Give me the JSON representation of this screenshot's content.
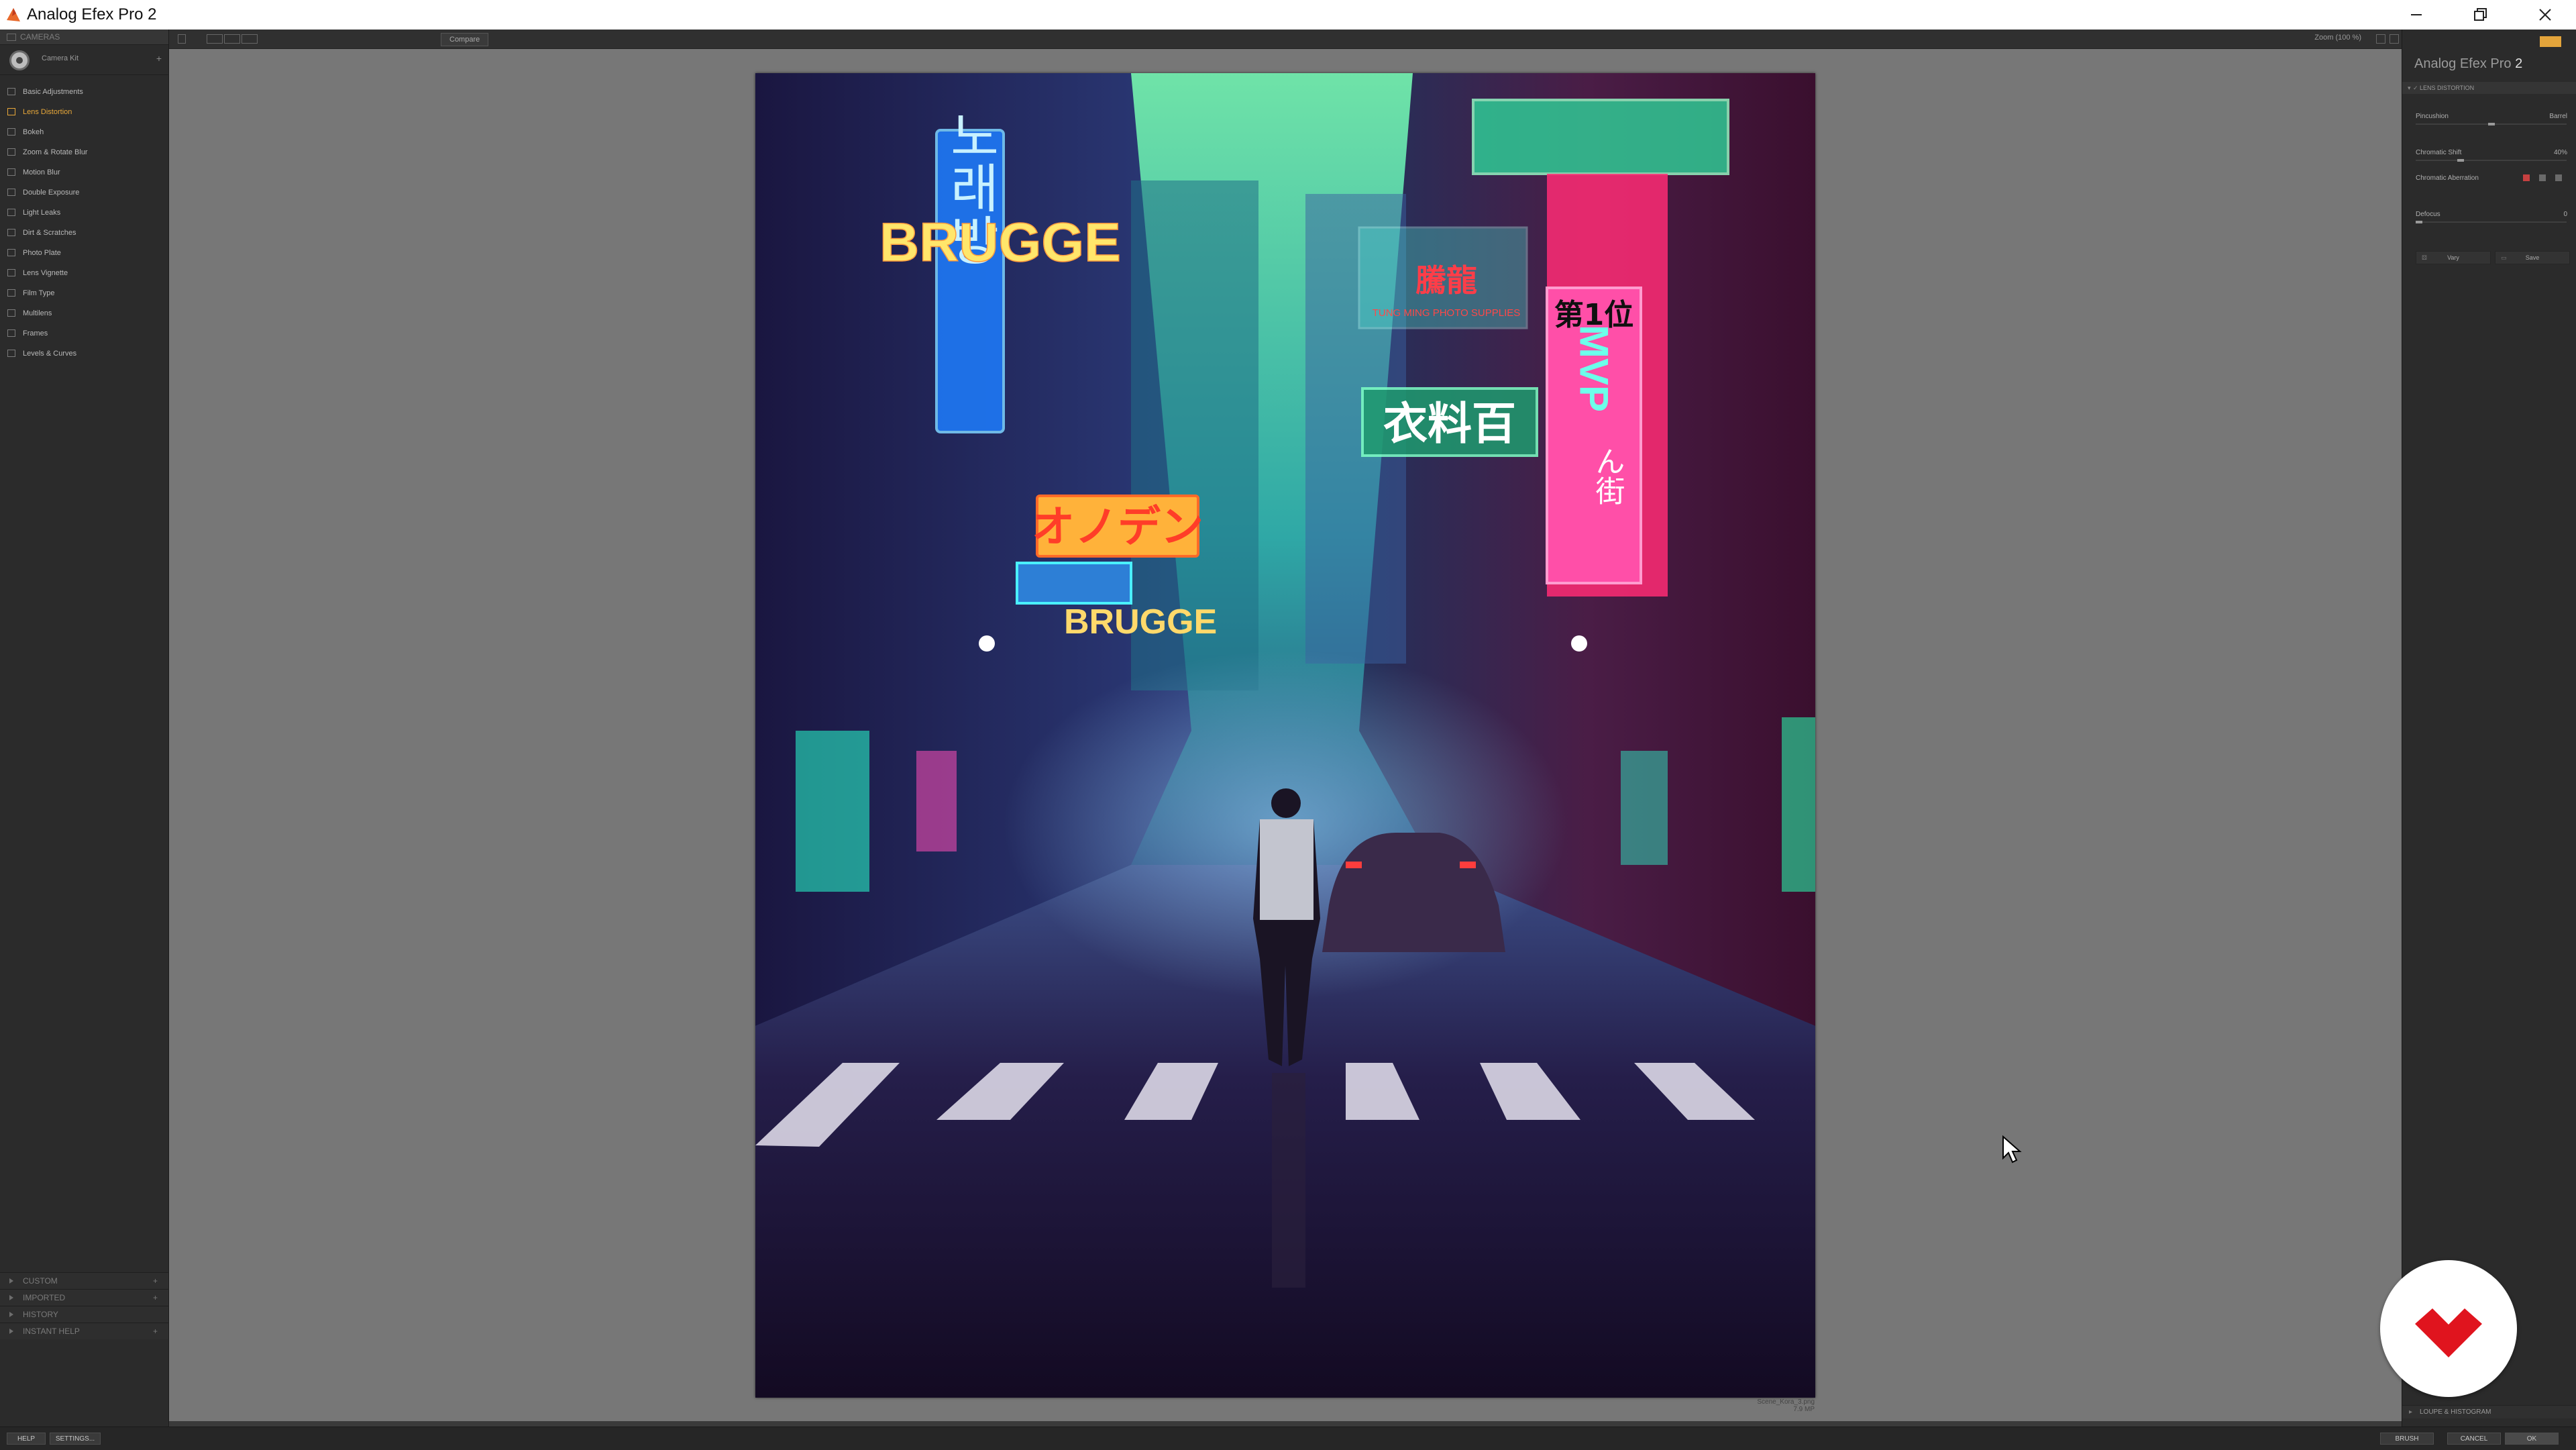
{
  "window": {
    "title": "Analog Efex Pro 2",
    "controls": [
      "minimize",
      "restore",
      "close"
    ]
  },
  "left_panel": {
    "header": "CAMERAS",
    "camera_kit": "Camera Kit",
    "tools": [
      {
        "label": "Basic Adjustments",
        "active": false
      },
      {
        "label": "Lens Distortion",
        "active": true
      },
      {
        "label": "Bokeh",
        "active": false
      },
      {
        "label": "Zoom & Rotate Blur",
        "active": false
      },
      {
        "label": "Motion Blur",
        "active": false
      },
      {
        "label": "Double Exposure",
        "active": false
      },
      {
        "label": "Light Leaks",
        "active": false
      },
      {
        "label": "Dirt & Scratches",
        "active": false
      },
      {
        "label": "Photo Plate",
        "active": false
      },
      {
        "label": "Lens Vignette",
        "active": false
      },
      {
        "label": "Film Type",
        "active": false
      },
      {
        "label": "Multilens",
        "active": false
      },
      {
        "label": "Frames",
        "active": false
      },
      {
        "label": "Levels & Curves",
        "active": false
      }
    ],
    "bottom_sections": [
      "CUSTOM",
      "IMPORTED",
      "HISTORY",
      "INSTANT HELP"
    ]
  },
  "toolbar": {
    "compare_label": "Compare",
    "zoom_label": "Zoom (100 %)"
  },
  "canvas": {
    "file_name": "Scene_Kora_3.png",
    "file_size": "7.9 MP",
    "photo_signs": {
      "brugge_top": "BRUGGE",
      "korean": "노래방",
      "katakana": "オノデン",
      "brugge_bottom": "BRUGGE",
      "rank": "第1位",
      "mvp": "MVP",
      "clothing": "衣料百",
      "hiragana": "ん街",
      "store_en": "TUNG MING PHOTO SUPPLIES",
      "store_cn": "騰龍"
    }
  },
  "right_panel": {
    "brand": "Analog Efex Pro",
    "brand_version": "2",
    "section_title": "LENS DISTORTION",
    "params": {
      "pincushion": "Pincushion",
      "barrel": "Barrel",
      "chromatic_shift": "Chromatic Shift",
      "chromatic_shift_value": "40%",
      "chromatic_aberration": "Chromatic Aberration",
      "defocus": "Defocus",
      "defocus_value": "0"
    },
    "buttons": {
      "vary": "Vary",
      "save": "Save"
    },
    "loupe_section": "LOUPE & HISTOGRAM",
    "accent": "#e8a83a"
  },
  "statusbar": {
    "help": "HELP",
    "settings": "SETTINGS...",
    "brush": "BRUSH",
    "cancel": "CANCEL",
    "ok": "OK"
  }
}
